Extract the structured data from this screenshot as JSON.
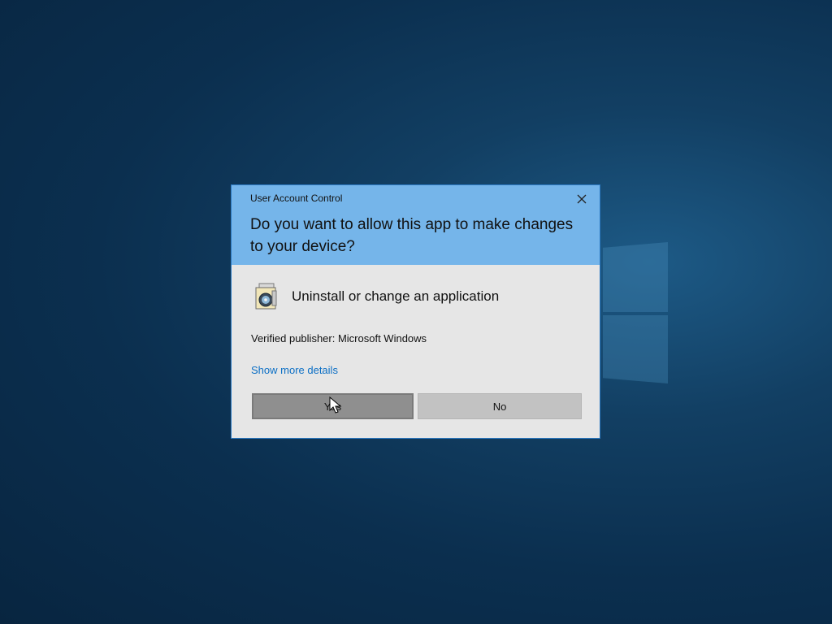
{
  "dialog": {
    "title": "User Account Control",
    "question": "Do you want to allow this app to make changes to your device?",
    "app_name": "Uninstall or change an application",
    "app_icon": "installer-disc-icon",
    "publisher_label": "Verified publisher:",
    "publisher_name": "Microsoft Windows",
    "details_link": "Show more details",
    "yes_label": "Yes",
    "no_label": "No",
    "close_icon": "close-icon"
  },
  "colors": {
    "header": "#75b5ea",
    "body": "#e6e6e6",
    "link": "#0c6fc5",
    "yes_button": "#8f8f8f",
    "no_button": "#c2c2c2"
  }
}
